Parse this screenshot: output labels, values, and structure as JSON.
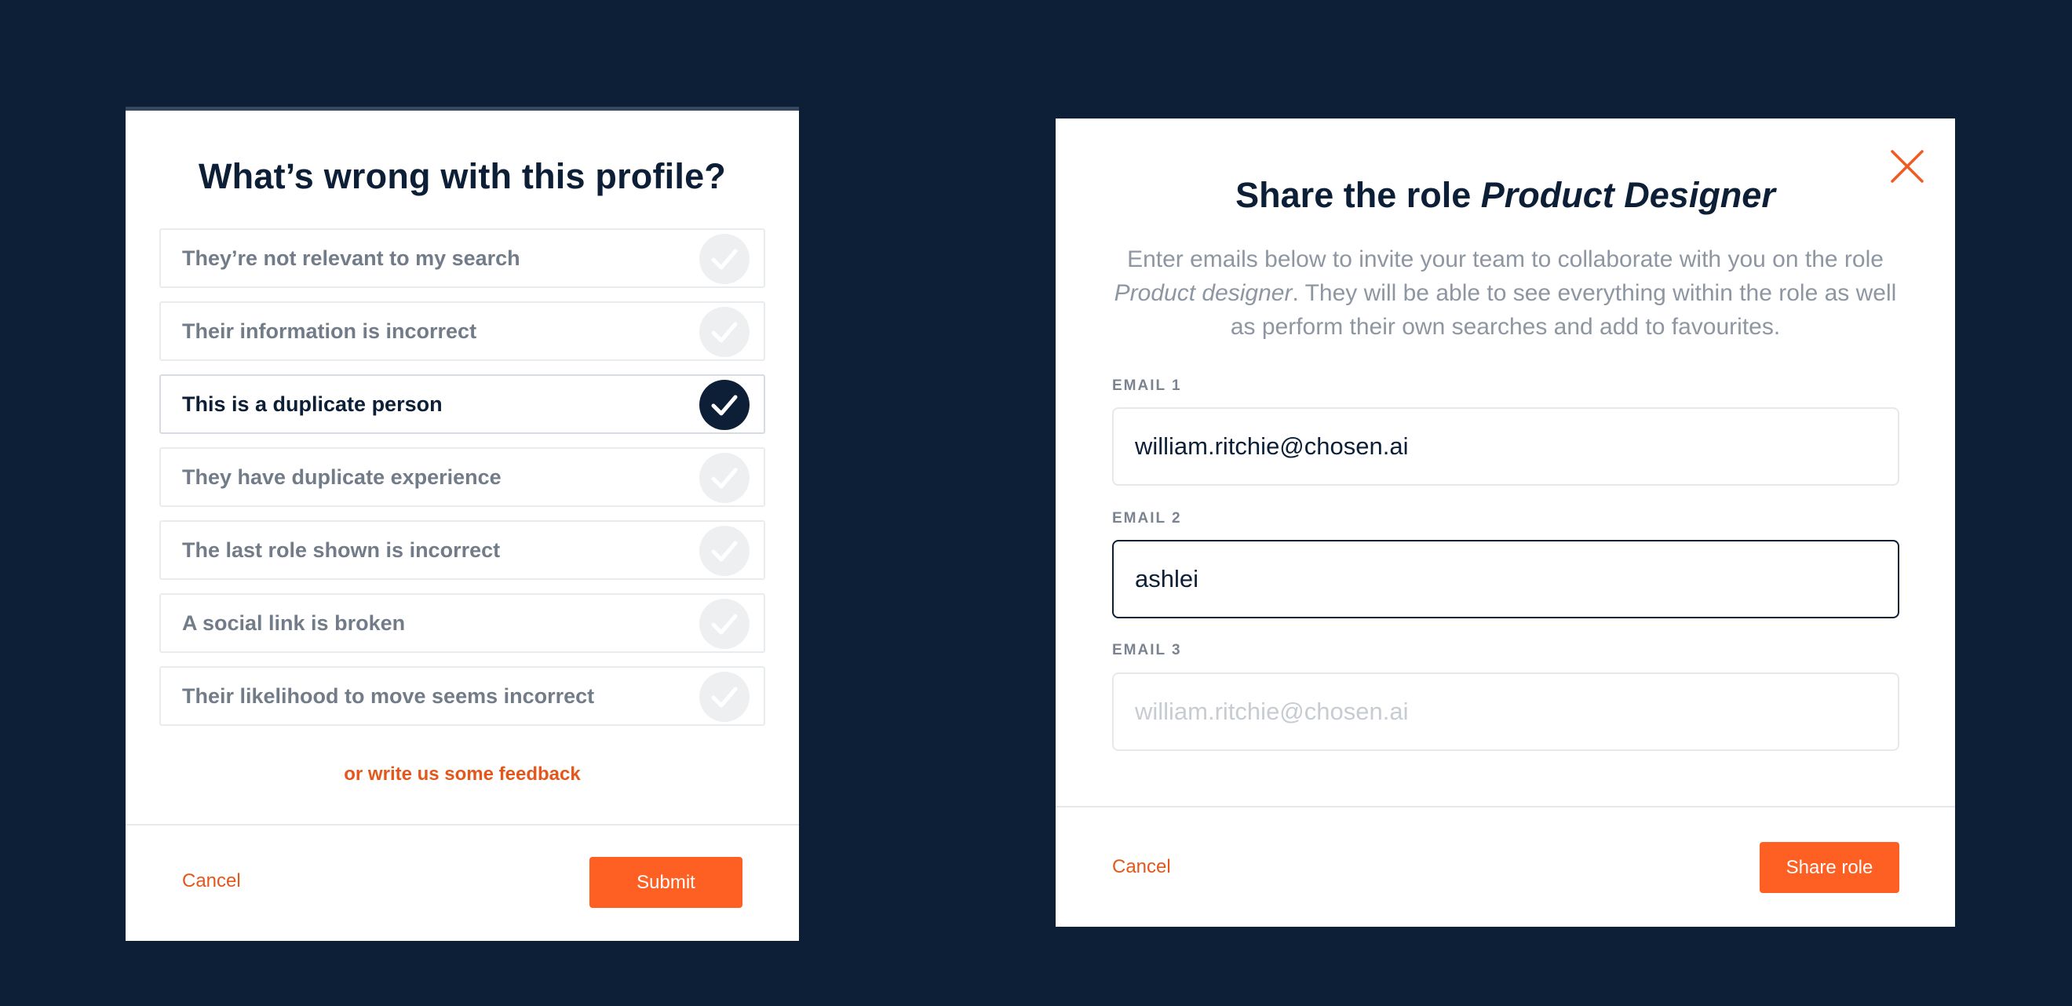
{
  "report_modal": {
    "title": "What’s wrong with this profile?",
    "options": [
      {
        "label": "They’re not relevant to my search",
        "selected": false
      },
      {
        "label": "Their information is incorrect",
        "selected": false
      },
      {
        "label": "This is a duplicate person",
        "selected": true
      },
      {
        "label": "They have duplicate experience",
        "selected": false
      },
      {
        "label": "The last role shown is incorrect",
        "selected": false
      },
      {
        "label": "A social link is broken",
        "selected": false
      },
      {
        "label": "Their likelihood to move seems incorrect",
        "selected": false
      }
    ],
    "feedback_link": "or write us some feedback",
    "cancel_label": "Cancel",
    "submit_label": "Submit"
  },
  "share_modal": {
    "title_prefix": "Share the role ",
    "title_role": "Product Designer",
    "desc_before": "Enter emails below to invite your team to collaborate with you on the role ",
    "desc_role": "Product designer",
    "desc_after": ". They will be able to see everything within the role as well as perform their own searches and add to favourites.",
    "emails": [
      {
        "label": "EMAIL 1",
        "value": "william.ritchie@chosen.ai",
        "placeholder": "",
        "focused": false
      },
      {
        "label": "EMAIL 2",
        "value": "ashlei",
        "placeholder": "",
        "focused": true
      },
      {
        "label": "EMAIL 3",
        "value": "",
        "placeholder": "william.ritchie@chosen.ai",
        "focused": false
      }
    ],
    "cancel_label": "Cancel",
    "share_label": "Share role"
  },
  "colors": {
    "background": "#0c1f36",
    "accent": "#fe5f23",
    "link": "#e5561b",
    "selected_check": "#0c1f36",
    "unselected_check": "#eeeff1"
  },
  "icons": {
    "check": "check-icon",
    "close": "close-icon"
  }
}
